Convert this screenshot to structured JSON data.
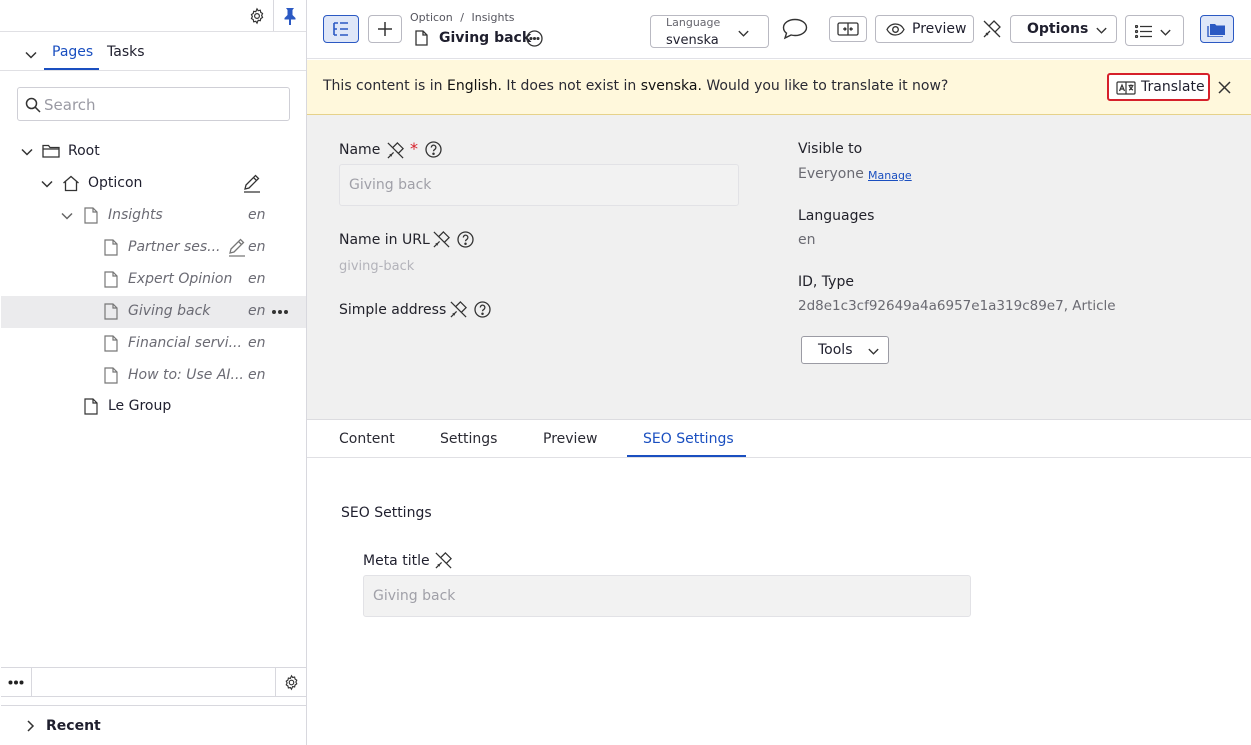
{
  "sidebar": {
    "tabs": [
      {
        "label": "Pages"
      },
      {
        "label": "Tasks"
      }
    ],
    "search_placeholder": "Search",
    "tree": [
      {
        "label": "Root",
        "lang": "",
        "italic": false
      },
      {
        "label": "Opticon",
        "lang": "",
        "italic": false
      },
      {
        "label": "Insights",
        "lang": "en",
        "italic": true
      },
      {
        "label": "Partner ses...",
        "lang": "en",
        "italic": true
      },
      {
        "label": "Expert Opinion",
        "lang": "en",
        "italic": true
      },
      {
        "label": "Giving back",
        "lang": "en",
        "italic": true
      },
      {
        "label": "Financial servi...",
        "lang": "en",
        "italic": true
      },
      {
        "label": "How to: Use AI...",
        "lang": "en",
        "italic": true
      },
      {
        "label": "Le Group",
        "lang": "",
        "italic": false
      }
    ],
    "recent_label": "Recent"
  },
  "toolbar": {
    "breadcrumb_parent": "Opticon",
    "breadcrumb_sep": "/",
    "breadcrumb_current": "Insights",
    "page_name": "Giving back",
    "language_label": "Language",
    "language_value": "svenska",
    "preview_label": "Preview",
    "options_label": "Options"
  },
  "banner": {
    "text_1": "This content is in ",
    "source_lang": "English.",
    "text_2": " It does not exist in ",
    "target_lang": "svenska.",
    "text_3": " Would you like to translate it now?",
    "translate_label": "Translate"
  },
  "properties": {
    "name_label": "Name",
    "required_mark": "*",
    "name_value": "Giving back",
    "url_label": "Name in URL",
    "url_value": "giving-back",
    "simple_address_label": "Simple address",
    "visible_to_label": "Visible to",
    "visible_to_value": "Everyone",
    "manage_link": "Manage",
    "languages_label": "Languages",
    "languages_value": "en",
    "id_type_label": "ID, Type",
    "id_type_value": "2d8e1c3cf92649a4a6957e1a319c89e7, Article",
    "tools_label": "Tools"
  },
  "content_tabs": [
    {
      "label": "Content"
    },
    {
      "label": "Settings"
    },
    {
      "label": "Preview"
    },
    {
      "label": "SEO Settings",
      "active": true
    }
  ],
  "seo": {
    "section_title": "SEO Settings",
    "meta_title_label": "Meta title",
    "meta_title_value": "Giving back"
  },
  "colors": {
    "accent": "#1a4fc0",
    "banner_bg": "#fff8dc",
    "highlight_border": "#d6202a",
    "pin": "#2b59c3"
  }
}
